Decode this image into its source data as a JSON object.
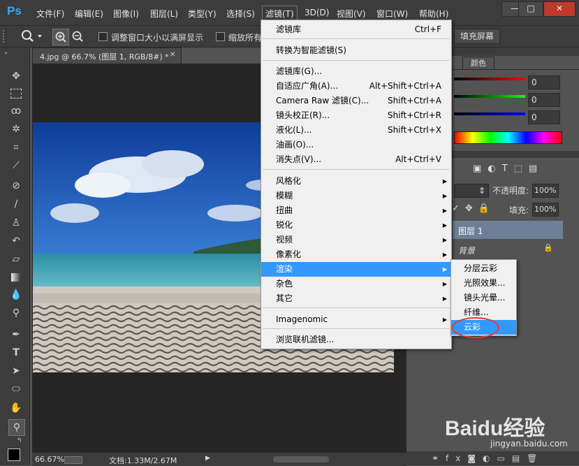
{
  "app": {
    "logo": "Ps"
  },
  "menubar": {
    "items": [
      "文件(F)",
      "编辑(E)",
      "图像(I)",
      "图层(L)",
      "类型(Y)",
      "选择(S)",
      "滤镜(T)",
      "3D(D)",
      "视图(V)",
      "窗口(W)",
      "帮助(H)"
    ],
    "active": "滤镜(T)",
    "window_buttons": {
      "minimize": "—",
      "maximize": "□",
      "close": "✕"
    }
  },
  "options_bar": {
    "resize_label": "调整窗口大小以满屏显示",
    "zoom_all_label": "缩放所有",
    "fill_screen_label": "填充屏幕"
  },
  "document": {
    "tab_title": "4.jpg @ 66.7% (图层 1, RGB/8#) *",
    "close": "✕"
  },
  "statusbar": {
    "zoom": "66.67%",
    "doc_info": "文档:1.33M/2.67M"
  },
  "filter_menu": {
    "items": [
      {
        "label": "滤镜库",
        "shortcut": "Ctrl+F"
      },
      {
        "label": "转换为智能滤镜(S)",
        "shortcut": ""
      },
      {
        "label": "滤镜库(G)...",
        "shortcut": ""
      },
      {
        "label": "自适应广角(A)...",
        "shortcut": "Alt+Shift+Ctrl+A"
      },
      {
        "label": "Camera Raw 滤镜(C)...",
        "shortcut": "Shift+Ctrl+A"
      },
      {
        "label": "镜头校正(R)...",
        "shortcut": "Shift+Ctrl+R"
      },
      {
        "label": "液化(L)...",
        "shortcut": "Shift+Ctrl+X"
      },
      {
        "label": "油画(O)...",
        "shortcut": ""
      },
      {
        "label": "消失点(V)...",
        "shortcut": "Alt+Ctrl+V"
      },
      {
        "label": "风格化",
        "shortcut": ""
      },
      {
        "label": "模糊",
        "shortcut": ""
      },
      {
        "label": "扭曲",
        "shortcut": ""
      },
      {
        "label": "锐化",
        "shortcut": ""
      },
      {
        "label": "视频",
        "shortcut": ""
      },
      {
        "label": "像素化",
        "shortcut": ""
      },
      {
        "label": "渲染",
        "shortcut": ""
      },
      {
        "label": "杂色",
        "shortcut": ""
      },
      {
        "label": "其它",
        "shortcut": ""
      },
      {
        "label": "Imagenomic",
        "shortcut": ""
      },
      {
        "label": "浏览联机滤镜...",
        "shortcut": ""
      }
    ],
    "highlighted": "渲染"
  },
  "render_submenu": {
    "items": [
      "分层云彩",
      "光照效果...",
      "镜头光晕...",
      "纤维...",
      "云彩"
    ],
    "highlighted": "云彩"
  },
  "color_panel": {
    "tab": "颜色",
    "values": [
      "0",
      "0",
      "0"
    ]
  },
  "layers_panel": {
    "opacity_label": "不透明度:",
    "opacity_value": "100%",
    "fill_label": "填充:",
    "fill_value": "100%",
    "layers": [
      {
        "name": "图层 1",
        "selected": true
      },
      {
        "name": "背景",
        "selected": false,
        "locked": true
      }
    ]
  },
  "watermark": {
    "text": "Baidu经验",
    "url": "jingyan.baidu.com"
  },
  "colors": {
    "highlight": "#3399ff",
    "annotation": "#e53935",
    "ps_blue": "#31a8ff"
  }
}
